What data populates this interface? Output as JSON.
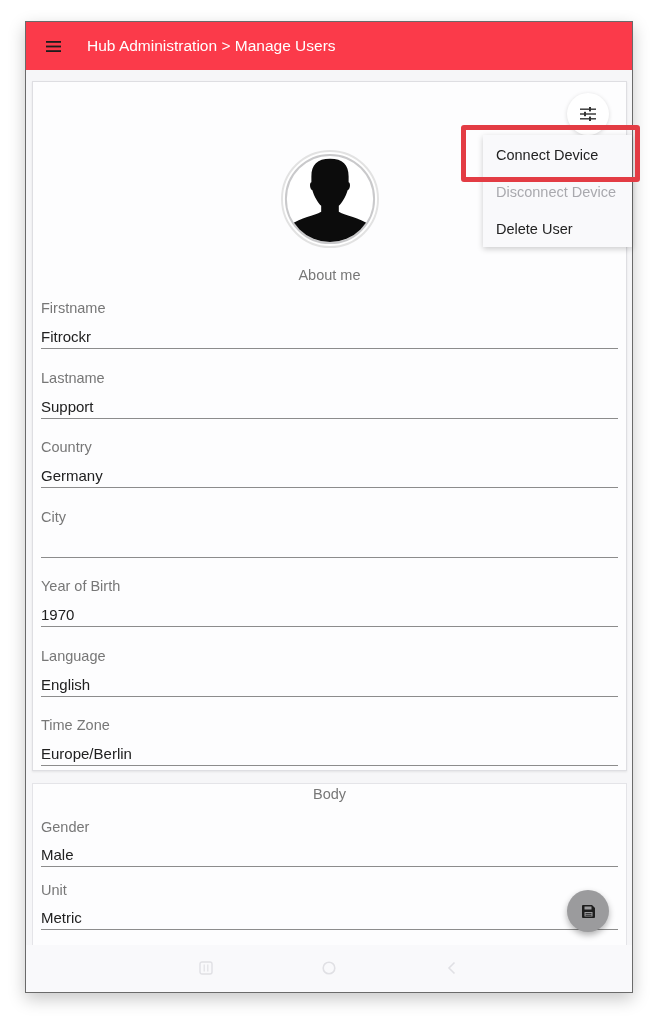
{
  "app_bar": {
    "title": "Hub Administration > Manage Users"
  },
  "menu": {
    "items": [
      {
        "label": "Connect Device",
        "disabled": false,
        "highlighted": true
      },
      {
        "label": "Disconnect Device",
        "disabled": true,
        "highlighted": false
      },
      {
        "label": "Delete User",
        "disabled": false,
        "highlighted": false
      }
    ]
  },
  "profile_card": {
    "caption": "About me",
    "fields": [
      {
        "label": "Firstname",
        "value": "Fitrockr"
      },
      {
        "label": "Lastname",
        "value": "Support"
      },
      {
        "label": "Country",
        "value": "Germany"
      },
      {
        "label": "City"
      },
      {
        "label": "Year of Birth",
        "value": "1970"
      },
      {
        "label": "Language",
        "value": "English"
      },
      {
        "label": "Time Zone",
        "value": "Europe/Berlin"
      }
    ]
  },
  "body_card": {
    "title": "Body",
    "fields": [
      {
        "label": "Gender",
        "value": "Male"
      },
      {
        "label": "Unit",
        "value": "Metric"
      }
    ]
  }
}
